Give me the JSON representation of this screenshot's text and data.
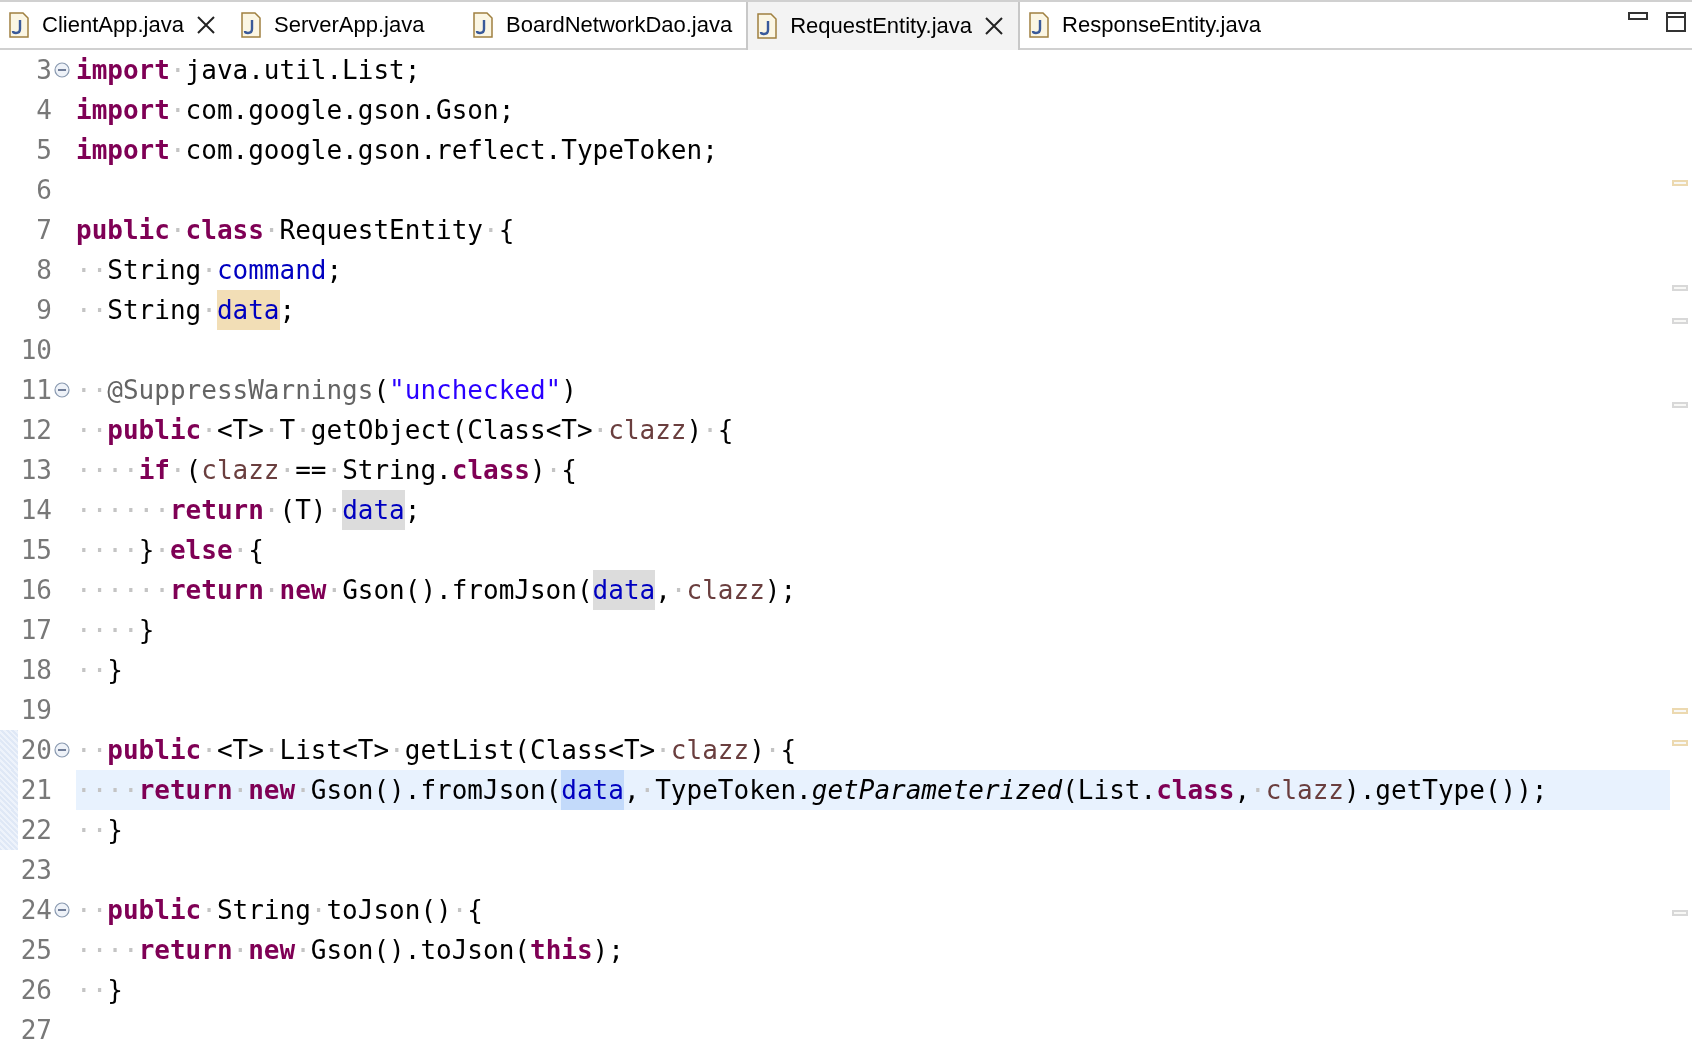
{
  "tabs": [
    {
      "label": "ClientApp.java",
      "selected": false,
      "closable": true
    },
    {
      "label": "ServerApp.java",
      "selected": false,
      "closable": false
    },
    {
      "label": "BoardNetworkDao.java",
      "selected": false,
      "closable": false
    },
    {
      "label": "RequestEntity.java",
      "selected": true,
      "closable": true
    },
    {
      "label": "ResponseEntity.java",
      "selected": false,
      "closable": false
    }
  ],
  "lines": [
    {
      "number": "3",
      "fold": true,
      "current": false,
      "changed": false,
      "tokens": [
        {
          "kind": "kw",
          "t": "import"
        },
        {
          "kind": "ws",
          "t": "·"
        },
        {
          "kind": "plain",
          "t": "java.util.List;"
        }
      ]
    },
    {
      "number": "4",
      "fold": false,
      "current": false,
      "changed": false,
      "tokens": [
        {
          "kind": "kw",
          "t": "import"
        },
        {
          "kind": "ws",
          "t": "·"
        },
        {
          "kind": "plain",
          "t": "com.google.gson.Gson;"
        }
      ]
    },
    {
      "number": "5",
      "fold": false,
      "current": false,
      "changed": false,
      "tokens": [
        {
          "kind": "kw",
          "t": "import"
        },
        {
          "kind": "ws",
          "t": "·"
        },
        {
          "kind": "plain",
          "t": "com.google.gson.reflect.TypeToken;"
        }
      ]
    },
    {
      "number": "6",
      "fold": false,
      "current": false,
      "changed": false
    },
    {
      "number": "7",
      "fold": false,
      "current": false,
      "changed": false,
      "tokens": [
        {
          "kind": "kw",
          "t": "public"
        },
        {
          "kind": "ws",
          "t": "·"
        },
        {
          "kind": "kw",
          "t": "class"
        },
        {
          "kind": "ws",
          "t": "·"
        },
        {
          "kind": "plain",
          "t": "RequestEntity"
        },
        {
          "kind": "ws",
          "t": "·"
        },
        {
          "kind": "plain",
          "t": "{"
        }
      ]
    },
    {
      "number": "8",
      "fold": false,
      "current": false,
      "changed": false,
      "tokens": [
        {
          "kind": "ws",
          "t": "··"
        },
        {
          "kind": "plain",
          "t": "String"
        },
        {
          "kind": "ws",
          "t": "·"
        },
        {
          "kind": "field",
          "t": "command"
        },
        {
          "kind": "plain",
          "t": ";"
        }
      ]
    },
    {
      "number": "9",
      "fold": false,
      "current": false,
      "changed": false,
      "tokens": [
        {
          "kind": "ws",
          "t": "··"
        },
        {
          "kind": "plain",
          "t": "String"
        },
        {
          "kind": "ws",
          "t": "·"
        },
        {
          "kind": "field",
          "t": "data",
          "occurrence": true,
          "write": true,
          "selected": false
        },
        {
          "kind": "plain",
          "t": ";"
        }
      ]
    },
    {
      "number": "10",
      "fold": false,
      "current": false,
      "changed": false
    },
    {
      "number": "11",
      "fold": true,
      "current": false,
      "changed": false,
      "tokens": [
        {
          "kind": "ws",
          "t": "··"
        },
        {
          "kind": "annotation",
          "t": "@SuppressWarnings"
        },
        {
          "kind": "plain",
          "t": "("
        },
        {
          "kind": "string",
          "t": "\"unchecked\""
        },
        {
          "kind": "plain",
          "t": ")"
        }
      ]
    },
    {
      "number": "12",
      "fold": false,
      "current": false,
      "changed": false,
      "tokens": [
        {
          "kind": "ws",
          "t": "··"
        },
        {
          "kind": "kw",
          "t": "public"
        },
        {
          "kind": "ws",
          "t": "·"
        },
        {
          "kind": "plain",
          "t": "<T>"
        },
        {
          "kind": "ws",
          "t": "·"
        },
        {
          "kind": "plain",
          "t": "T"
        },
        {
          "kind": "ws",
          "t": "·"
        },
        {
          "kind": "plain",
          "t": "getObject(Class<T>"
        },
        {
          "kind": "ws",
          "t": "·"
        },
        {
          "kind": "param",
          "t": "clazz"
        },
        {
          "kind": "plain",
          "t": ")"
        },
        {
          "kind": "ws",
          "t": "·"
        },
        {
          "kind": "plain",
          "t": "{"
        }
      ]
    },
    {
      "number": "13",
      "fold": false,
      "current": false,
      "changed": false,
      "tokens": [
        {
          "kind": "ws",
          "t": "····"
        },
        {
          "kind": "kw",
          "t": "if"
        },
        {
          "kind": "ws",
          "t": "·"
        },
        {
          "kind": "plain",
          "t": "("
        },
        {
          "kind": "param",
          "t": "clazz"
        },
        {
          "kind": "ws",
          "t": "·"
        },
        {
          "kind": "plain",
          "t": "=="
        },
        {
          "kind": "ws",
          "t": "·"
        },
        {
          "kind": "plain",
          "t": "String."
        },
        {
          "kind": "kw",
          "t": "class"
        },
        {
          "kind": "plain",
          "t": ")"
        },
        {
          "kind": "ws",
          "t": "·"
        },
        {
          "kind": "plain",
          "t": "{"
        }
      ]
    },
    {
      "number": "14",
      "fold": false,
      "current": false,
      "changed": false,
      "tokens": [
        {
          "kind": "ws",
          "t": "······"
        },
        {
          "kind": "kw",
          "t": "return"
        },
        {
          "kind": "ws",
          "t": "·"
        },
        {
          "kind": "plain",
          "t": "(T)"
        },
        {
          "kind": "ws",
          "t": "·"
        },
        {
          "kind": "field",
          "t": "data",
          "occurrence": true,
          "write": false,
          "selected": false
        },
        {
          "kind": "plain",
          "t": ";"
        }
      ]
    },
    {
      "number": "15",
      "fold": false,
      "current": false,
      "changed": false,
      "tokens": [
        {
          "kind": "ws",
          "t": "····"
        },
        {
          "kind": "plain",
          "t": "}"
        },
        {
          "kind": "ws",
          "t": "·"
        },
        {
          "kind": "kw",
          "t": "else"
        },
        {
          "kind": "ws",
          "t": "·"
        },
        {
          "kind": "plain",
          "t": "{"
        }
      ]
    },
    {
      "number": "16",
      "fold": false,
      "current": false,
      "changed": false,
      "tokens": [
        {
          "kind": "ws",
          "t": "······"
        },
        {
          "kind": "kw",
          "t": "return"
        },
        {
          "kind": "ws",
          "t": "·"
        },
        {
          "kind": "kw",
          "t": "new"
        },
        {
          "kind": "ws",
          "t": "·"
        },
        {
          "kind": "plain",
          "t": "Gson().fromJson("
        },
        {
          "kind": "field",
          "t": "data",
          "occurrence": true,
          "write": false,
          "selected": false
        },
        {
          "kind": "plain",
          "t": ","
        },
        {
          "kind": "ws",
          "t": "·"
        },
        {
          "kind": "param",
          "t": "clazz"
        },
        {
          "kind": "plain",
          "t": ");"
        }
      ]
    },
    {
      "number": "17",
      "fold": false,
      "current": false,
      "changed": false,
      "tokens": [
        {
          "kind": "ws",
          "t": "····"
        },
        {
          "kind": "plain",
          "t": "}"
        }
      ]
    },
    {
      "number": "18",
      "fold": false,
      "current": false,
      "changed": false,
      "tokens": [
        {
          "kind": "ws",
          "t": "··"
        },
        {
          "kind": "plain",
          "t": "}"
        }
      ]
    },
    {
      "number": "19",
      "fold": false,
      "current": false,
      "changed": false
    },
    {
      "number": "20",
      "fold": true,
      "current": false,
      "changed": true,
      "tokens": [
        {
          "kind": "ws",
          "t": "··"
        },
        {
          "kind": "kw",
          "t": "public"
        },
        {
          "kind": "ws",
          "t": "·"
        },
        {
          "kind": "plain",
          "t": "<T>"
        },
        {
          "kind": "ws",
          "t": "·"
        },
        {
          "kind": "plain",
          "t": "List<T>"
        },
        {
          "kind": "ws",
          "t": "·"
        },
        {
          "kind": "plain",
          "t": "getList(Class<T>"
        },
        {
          "kind": "ws",
          "t": "·"
        },
        {
          "kind": "param",
          "t": "clazz"
        },
        {
          "kind": "plain",
          "t": ")"
        },
        {
          "kind": "ws",
          "t": "·"
        },
        {
          "kind": "plain",
          "t": "{"
        }
      ]
    },
    {
      "number": "21",
      "fold": false,
      "current": true,
      "changed": true,
      "tokens": [
        {
          "kind": "ws",
          "t": "····"
        },
        {
          "kind": "kw",
          "t": "return"
        },
        {
          "kind": "ws",
          "t": "·"
        },
        {
          "kind": "kw",
          "t": "new"
        },
        {
          "kind": "ws",
          "t": "·"
        },
        {
          "kind": "plain",
          "t": "Gson().fromJson("
        },
        {
          "kind": "field",
          "t": "data",
          "occurrence": true,
          "write": false,
          "selected": true
        },
        {
          "kind": "plain",
          "t": ","
        },
        {
          "kind": "ws",
          "t": "·"
        },
        {
          "kind": "plain",
          "t": "TypeToken."
        },
        {
          "kind": "italic",
          "t": "getParameterized"
        },
        {
          "kind": "plain",
          "t": "(List."
        },
        {
          "kind": "kw",
          "t": "class"
        },
        {
          "kind": "plain",
          "t": ","
        },
        {
          "kind": "ws",
          "t": "·"
        },
        {
          "kind": "param",
          "t": "clazz"
        },
        {
          "kind": "plain",
          "t": ").getType());"
        }
      ]
    },
    {
      "number": "22",
      "fold": false,
      "current": false,
      "changed": true,
      "tokens": [
        {
          "kind": "ws",
          "t": "··"
        },
        {
          "kind": "plain",
          "t": "}"
        }
      ]
    },
    {
      "number": "23",
      "fold": false,
      "current": false,
      "changed": false
    },
    {
      "number": "24",
      "fold": true,
      "current": false,
      "changed": false,
      "tokens": [
        {
          "kind": "ws",
          "t": "··"
        },
        {
          "kind": "kw",
          "t": "public"
        },
        {
          "kind": "ws",
          "t": "·"
        },
        {
          "kind": "plain",
          "t": "String"
        },
        {
          "kind": "ws",
          "t": "·"
        },
        {
          "kind": "plain",
          "t": "toJson()"
        },
        {
          "kind": "ws",
          "t": "·"
        },
        {
          "kind": "plain",
          "t": "{"
        }
      ]
    },
    {
      "number": "25",
      "fold": false,
      "current": false,
      "changed": false,
      "tokens": [
        {
          "kind": "ws",
          "t": "····"
        },
        {
          "kind": "kw",
          "t": "return"
        },
        {
          "kind": "ws",
          "t": "·"
        },
        {
          "kind": "kw",
          "t": "new"
        },
        {
          "kind": "ws",
          "t": "·"
        },
        {
          "kind": "plain",
          "t": "Gson().toJson("
        },
        {
          "kind": "kw",
          "t": "this"
        },
        {
          "kind": "plain",
          "t": ");"
        }
      ]
    },
    {
      "number": "26",
      "fold": false,
      "current": false,
      "changed": false,
      "tokens": [
        {
          "kind": "ws",
          "t": "··"
        },
        {
          "kind": "plain",
          "t": "}"
        }
      ]
    },
    {
      "number": "27",
      "fold": false,
      "current": false,
      "changed": false
    }
  ]
}
